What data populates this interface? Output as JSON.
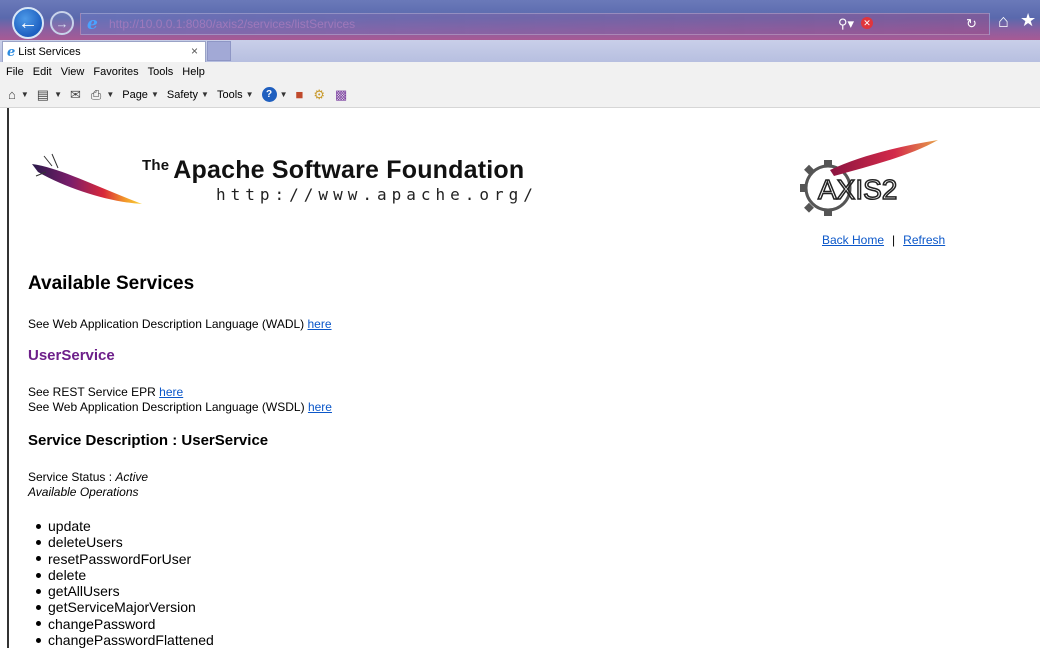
{
  "browser": {
    "address_url": "http://10.0.0.1:8080/axis2/services/listServices",
    "tab_title": "List Services",
    "tab_close": "×",
    "menu": [
      "File",
      "Edit",
      "View",
      "Favorites",
      "Tools",
      "Help"
    ],
    "command_bar": {
      "page": "Page",
      "safety": "Safety",
      "tools": "Tools"
    },
    "icons": [
      "back-icon",
      "forward-icon",
      "search-icon",
      "stop-icon",
      "refresh-icon",
      "home-icon",
      "favorites-star-icon",
      "help-icon"
    ]
  },
  "header": {
    "asf_the": "The",
    "asf_title": "Apache Software Foundation",
    "asf_url": "http://www.apache.org/",
    "axis_logo_text": "AXIS2",
    "links": {
      "back_home": "Back Home",
      "separator": "|",
      "refresh": "Refresh"
    }
  },
  "main": {
    "heading": "Available Services",
    "wadl_text": "See Web Application Description Language (WADL) ",
    "wadl_link": "here",
    "service": {
      "name": "UserService",
      "epr_text": "See REST Service EPR ",
      "epr_link": "here",
      "wsdl_text": "See Web Application Description Language (WSDL) ",
      "wsdl_link": "here",
      "description_heading": "Service Description : UserService",
      "status_label": "Service Status : ",
      "status_value": "Active",
      "operations_label": "Available Operations",
      "operations": [
        "update",
        "deleteUsers",
        "resetPasswordForUser",
        "delete",
        "getAllUsers",
        "getServiceMajorVersion",
        "changePassword",
        "changePasswordFlattened"
      ]
    }
  },
  "colors": {
    "link": "#0b57c9",
    "service_name": "#6d1f8a"
  }
}
